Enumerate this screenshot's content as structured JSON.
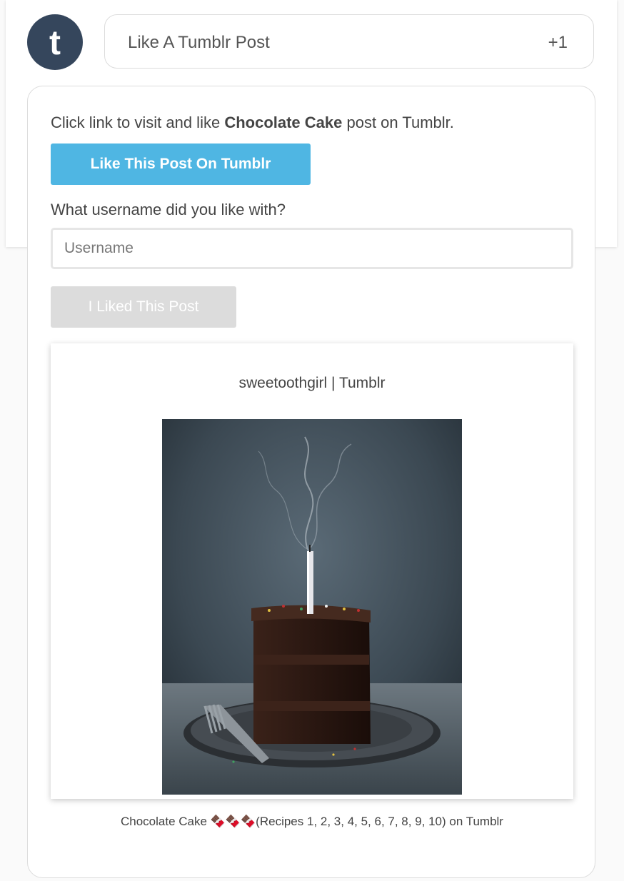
{
  "header": {
    "logo_letter": "t",
    "task_title": "Like A Tumblr Post",
    "points": "+1"
  },
  "task": {
    "instruction_prefix": "Click link to visit and like ",
    "post_name": "Chocolate Cake",
    "instruction_suffix": " post on Tumblr.",
    "like_button_label": "Like This Post On Tumblr",
    "username_question": "What username did you like with?",
    "username_placeholder": "Username",
    "username_value": "",
    "confirm_button_label": "I Liked This Post"
  },
  "embed": {
    "title": "sweetoothgirl | Tumblr",
    "caption": "Chocolate Cake 🍫🍫🍫(Recipes 1, 2, 3, 4, 5, 6, 7, 8, 9, 10) on Tumblr"
  },
  "colors": {
    "tumblr_navy": "#35465c",
    "like_button": "#4fb6e3",
    "disabled_button": "#dcdcdc"
  },
  "icons": {
    "logo": "tumblr-logo-icon"
  }
}
